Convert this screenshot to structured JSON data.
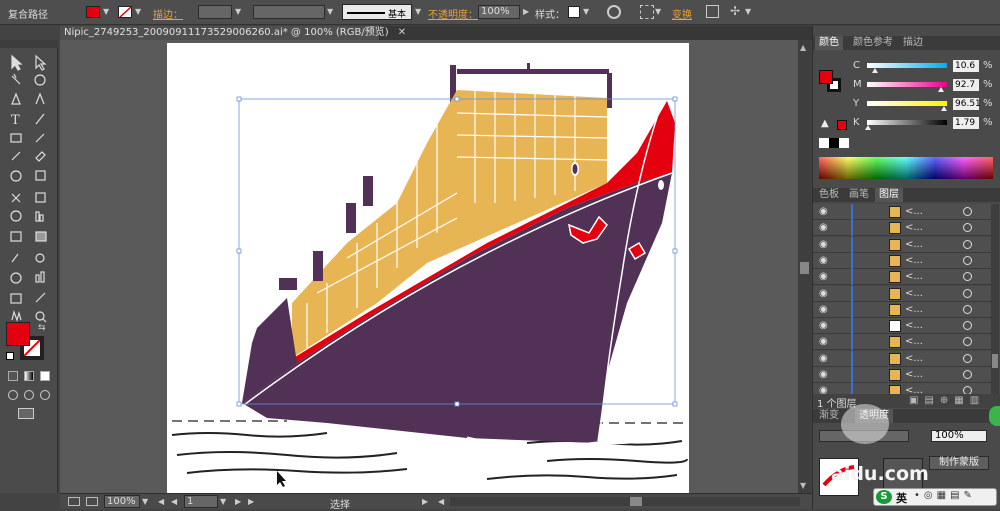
{
  "control_bar": {
    "object_type": "复合路径",
    "stroke_label": "描边：",
    "stroke_style": "基本",
    "opacity_label": "不透明度：",
    "opacity_value": "100%",
    "style_label": "样式：",
    "transform_label": "变换"
  },
  "document": {
    "tab_title": "Nipic_2749253_20090911173529006260.ai* @ 100% (RGB/预览)",
    "close_glyph": "✕"
  },
  "status_bar": {
    "zoom": "100%",
    "artboard": "1",
    "tool_name": "选择"
  },
  "color_panel": {
    "tabs": [
      "颜色",
      "颜色参考",
      "描边"
    ],
    "channels": [
      {
        "label": "C",
        "value": "10.6",
        "unit": "%",
        "fraction": 0.106
      },
      {
        "label": "M",
        "value": "92.7",
        "unit": "%",
        "fraction": 0.927
      },
      {
        "label": "Y",
        "value": "96.51",
        "unit": "%",
        "fraction": 0.9651
      },
      {
        "label": "K",
        "value": "1.79",
        "unit": "%",
        "fraction": 0.0179
      }
    ]
  },
  "layers_panel": {
    "tabs": [
      "色板",
      "画笔",
      "图层"
    ],
    "row_label": "<...",
    "count_label": "1 个图层",
    "rows": 12
  },
  "gradient_panel": {
    "tabs": [
      "渐变",
      "透明度"
    ],
    "opacity_value": "100%",
    "mask_button": "制作蒙版"
  },
  "watermark": {
    "text": "aidu.com",
    "ime_label": "英"
  },
  "colors": {
    "fill": "#e4000f",
    "hull_purple": "#523156",
    "container_gold": "#e7b553",
    "accent_orange": "#e8a33a"
  }
}
